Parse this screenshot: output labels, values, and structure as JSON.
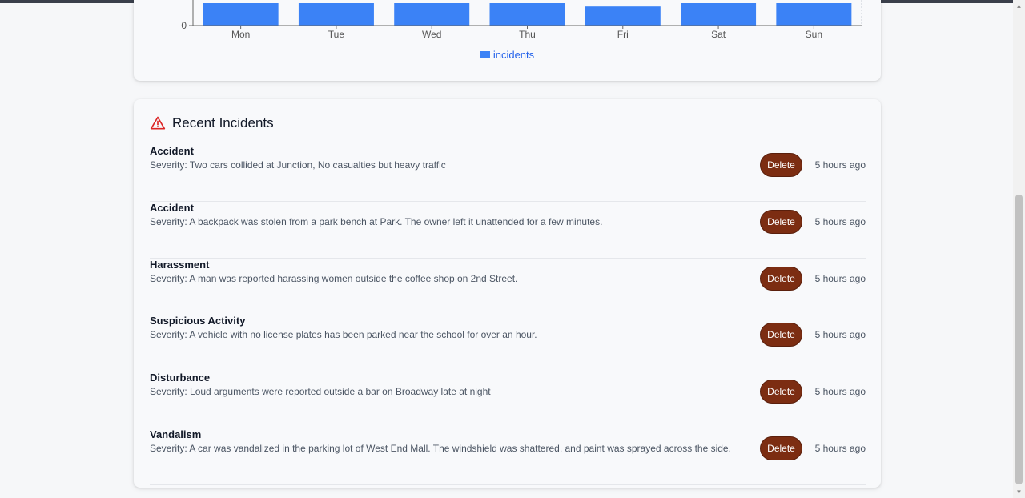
{
  "chart_data": {
    "type": "bar",
    "categories": [
      "Mon",
      "Tue",
      "Wed",
      "Thu",
      "Fri",
      "Sat",
      "Sun"
    ],
    "series": [
      {
        "name": "incidents",
        "values": [
          1,
          1,
          1,
          1,
          0.85,
          1,
          1
        ]
      }
    ],
    "ytick_visible": "0",
    "legend": "incidents",
    "legend_placement": "bottom",
    "colors": {
      "bar": "#3b82f6",
      "legend_text": "#2563eb"
    }
  },
  "incidents_panel": {
    "title": "Recent Incidents",
    "icon": "warning-triangle-icon",
    "delete_label": "Delete",
    "colors": {
      "delete_button": "#7c2d12",
      "warning_icon": "#dc2626"
    },
    "items": [
      {
        "type": "Accident",
        "description": "Severity: Two cars collided at Junction, No casualties but heavy traffic",
        "time": "5 hours ago"
      },
      {
        "type": "Accident",
        "description": "Severity: A backpack was stolen from a park bench at Park. The owner left it unattended for a few minutes.",
        "time": "5 hours ago"
      },
      {
        "type": "Harassment",
        "description": "Severity: A man was reported harassing women outside the coffee shop on 2nd Street.",
        "time": "5 hours ago"
      },
      {
        "type": "Suspicious Activity",
        "description": "Severity: A vehicle with no license plates has been parked near the school for over an hour.",
        "time": "5 hours ago"
      },
      {
        "type": "Disturbance",
        "description": "Severity: Loud arguments were reported outside a bar on Broadway late at night",
        "time": "5 hours ago"
      },
      {
        "type": "Vandalism",
        "description": "Severity: A car was vandalized in the parking lot of West End Mall. The windshield was shattered, and paint was sprayed across the side.",
        "time": "5 hours ago"
      }
    ]
  }
}
